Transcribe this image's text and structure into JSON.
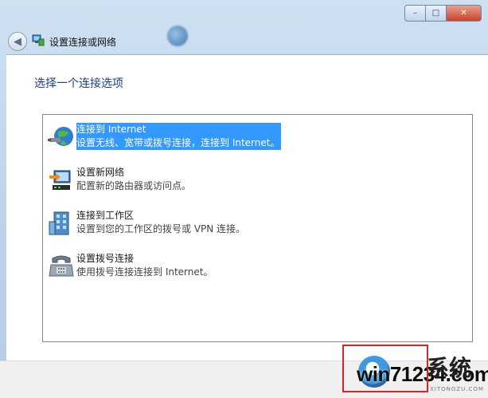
{
  "window": {
    "title": "设置连接或网络",
    "controls": {
      "minimize": "–",
      "maximize": "□",
      "close": "✕"
    },
    "back_glyph": "◀"
  },
  "main": {
    "heading": "选择一个连接选项",
    "options": [
      {
        "title": "连接到 Internet",
        "desc": "设置无线、宽带或拨号连接，连接到 Internet。",
        "icon": "globe-network-icon",
        "selected": true
      },
      {
        "title": "设置新网络",
        "desc": "配置新的路由器或访问点。",
        "icon": "router-setup-icon",
        "selected": false
      },
      {
        "title": "连接到工作区",
        "desc": "设置到您的工作区的拨号或 VPN 连接。",
        "icon": "workplace-building-icon",
        "selected": false
      },
      {
        "title": "设置拨号连接",
        "desc": "使用拨号连接连接到 Internet。",
        "icon": "dialup-phone-icon",
        "selected": false
      }
    ]
  },
  "watermark": {
    "text": "win71234.com",
    "brand": "系统",
    "sub": "XITONGZU.COM"
  },
  "colors": {
    "selection": "#3399ff",
    "heading": "#1e3f8a",
    "highlight_box": "#e02020"
  }
}
